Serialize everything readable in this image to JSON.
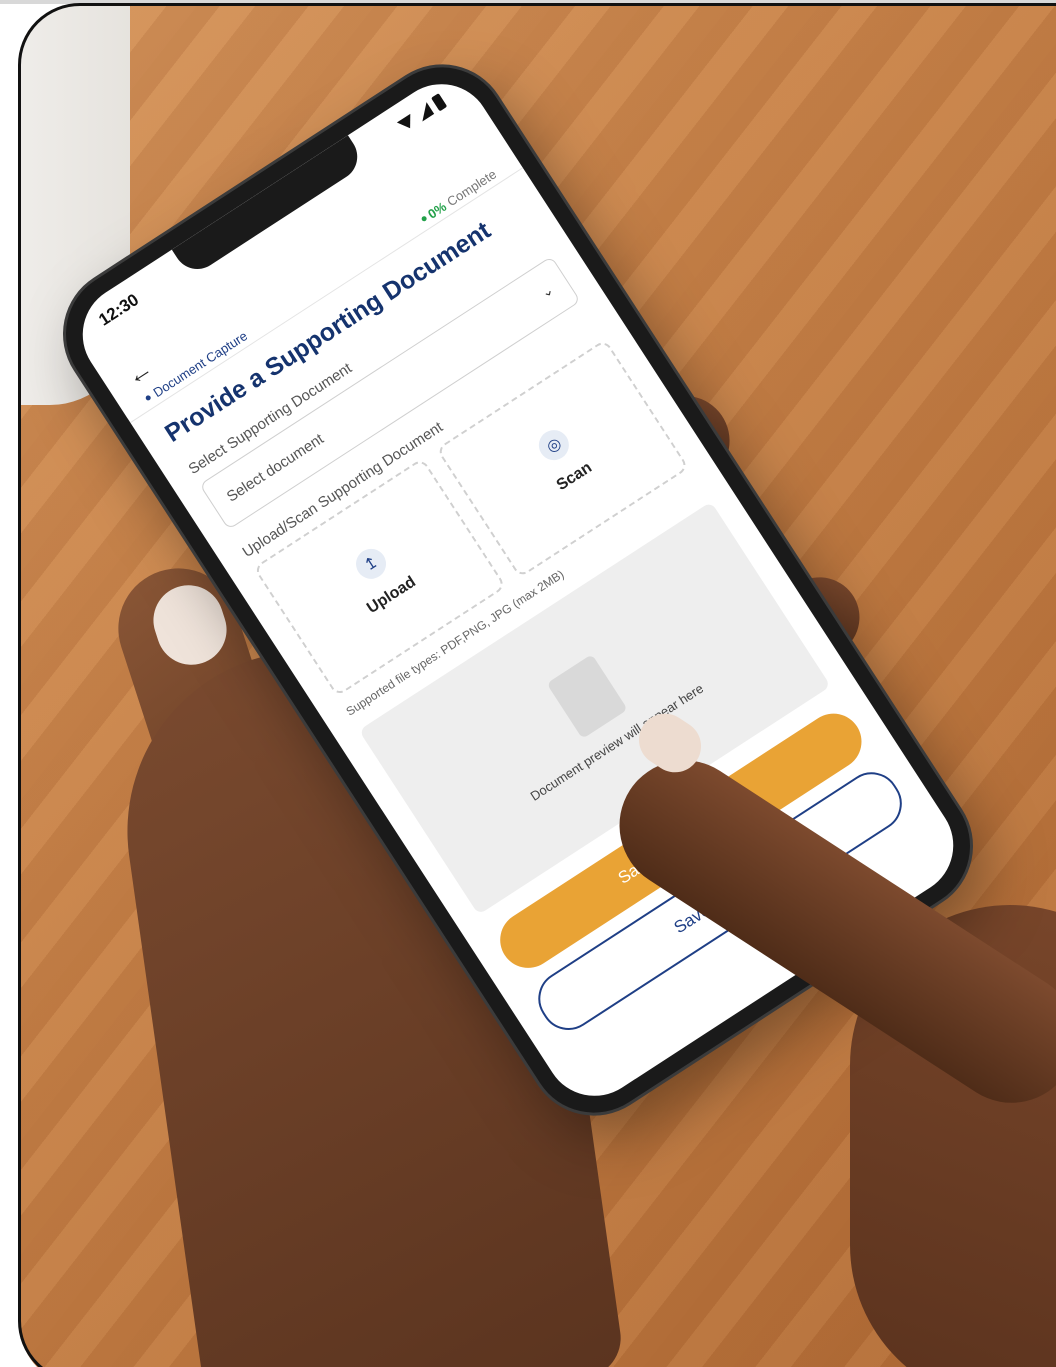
{
  "status_bar": {
    "time": "12:30"
  },
  "app": {
    "breadcrumb": "Document Capture",
    "progress_percent": "0%",
    "progress_suffix": "Complete",
    "title": "Provide a Supporting Document"
  },
  "form": {
    "select_label": "Select Supporting Document",
    "select_placeholder": "Select document",
    "upload_scan_label": "Upload/Scan Supporting Document",
    "upload_label": "Upload",
    "scan_label": "Scan",
    "file_types_hint": "Supported file types: PDF,PNG, JPG (max 2MB)",
    "preview_text": "Document preview will appear here"
  },
  "buttons": {
    "save_continue": "Save and Continue",
    "save_exit": "Save and Exit"
  },
  "icons": {
    "back": "back-arrow-icon",
    "upload": "upload-icon",
    "scan": "scan-icon",
    "chevron": "chevron-down-icon",
    "document": "document-icon"
  },
  "colors": {
    "brand_navy": "#15336e",
    "accent_orange": "#e9a335",
    "progress_green": "#23a14a"
  }
}
